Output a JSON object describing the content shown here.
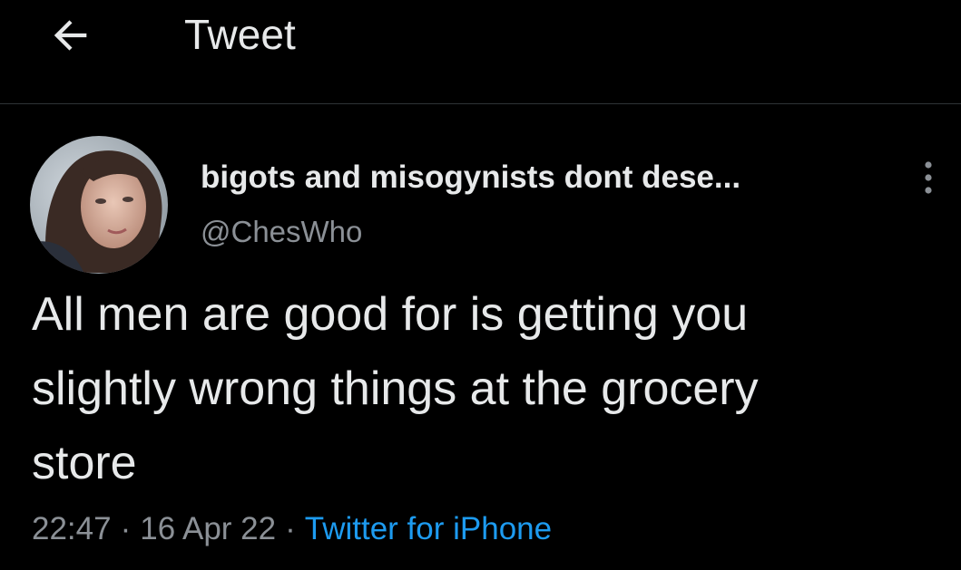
{
  "header": {
    "back_icon": "arrow-left-icon",
    "title": "Tweet"
  },
  "tweet": {
    "avatar_icon": "profile-avatar",
    "display_name": "bigots and misogynists dont dese...",
    "handle": "@ChesWho",
    "more_icon": "more-vertical-icon",
    "text": "All men are good for is getting you\nslightly wrong things at the grocery\nstore",
    "time": "22:47",
    "date": "16 Apr 22",
    "separator": "·",
    "source": "Twitter for iPhone"
  },
  "colors": {
    "background": "#000000",
    "text_primary": "#e7e9ea",
    "text_secondary": "#8b9096",
    "link": "#1d9bf0",
    "divider": "#2f3336"
  }
}
